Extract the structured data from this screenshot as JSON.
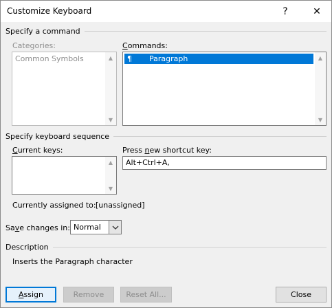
{
  "window": {
    "title": "Customize Keyboard",
    "help_label": "?",
    "close_label": "✕"
  },
  "command_section": {
    "heading": "Specify a command",
    "categories_label": "Categories:",
    "categories": [
      "Common Symbols"
    ],
    "commands_label_underlined": "C",
    "commands_label_rest": "ommands:",
    "commands": [
      {
        "glyph": "¶",
        "label": "Paragraph"
      }
    ]
  },
  "keyboard_section": {
    "heading": "Specify keyboard sequence",
    "current_keys_label_underlined": "C",
    "current_keys_label_rest": "urrent keys:",
    "press_new_label_pre": "Press ",
    "press_new_label_underlined": "n",
    "press_new_label_rest": "ew shortcut key:",
    "new_shortcut_value": "Alt+Ctrl+A,",
    "currently_assigned_label": "Currently assigned to:",
    "currently_assigned_value": "[unassigned]"
  },
  "save_changes": {
    "label_pre": "Sa",
    "label_underlined": "v",
    "label_rest": "e changes in:",
    "value": "Normal"
  },
  "description": {
    "heading": "Description",
    "text": "Inserts the Paragraph character"
  },
  "buttons": {
    "assign_underlined": "A",
    "assign_rest": "ssign",
    "remove": "Remove",
    "reset_all": "Reset All...",
    "close": "Close"
  }
}
